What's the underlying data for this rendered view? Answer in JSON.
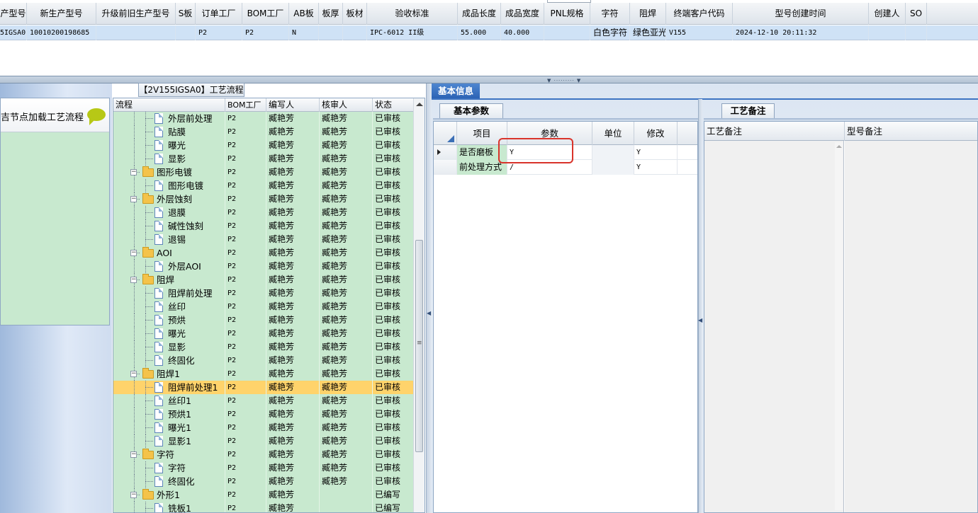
{
  "top_grid": {
    "columns": [
      "产型号",
      "新生产型号",
      "升级前旧生产型号",
      "S板",
      "订单工厂",
      "BOM工厂",
      "AB板",
      "板厚",
      "板材",
      "验收标准",
      "成品长度",
      "成品宽度",
      "PNL规格",
      "字符",
      "阻焊",
      "终端客户代码",
      "型号创建时间",
      "创建人",
      "SO"
    ],
    "row": [
      "5IGSA0",
      "10010200198685",
      "",
      "",
      "P2",
      "P2",
      "N",
      "",
      "",
      "IPC-6012 II级",
      "55.000",
      "40.000",
      "",
      "白色字符",
      "绿色亚光",
      "V155",
      "2024-12-10 20:11:32",
      "",
      ""
    ]
  },
  "left_panel": {
    "header_text": "吉节点加载工艺流程"
  },
  "flow_tab": {
    "title": "【2V155IGSA0】工艺流程"
  },
  "tree_grid": {
    "columns": [
      "流程",
      "BOM工厂",
      "编写人",
      "核审人",
      "状态"
    ],
    "rows": [
      {
        "label": "外层前处理",
        "level": 2,
        "type": "doc",
        "bom": "P2",
        "writer": "臧艳芳",
        "reviewer": "臧艳芳",
        "status": "已审核"
      },
      {
        "label": "贴膜",
        "level": 2,
        "type": "doc",
        "bom": "P2",
        "writer": "臧艳芳",
        "reviewer": "臧艳芳",
        "status": "已审核"
      },
      {
        "label": "曝光",
        "level": 2,
        "type": "doc",
        "bom": "P2",
        "writer": "臧艳芳",
        "reviewer": "臧艳芳",
        "status": "已审核"
      },
      {
        "label": "显影",
        "level": 2,
        "type": "doc",
        "bom": "P2",
        "writer": "臧艳芳",
        "reviewer": "臧艳芳",
        "status": "已审核"
      },
      {
        "label": "图形电镀",
        "level": 1,
        "type": "folder",
        "bom": "P2",
        "writer": "臧艳芳",
        "reviewer": "臧艳芳",
        "status": "已审核"
      },
      {
        "label": "图形电镀",
        "level": 2,
        "type": "doc",
        "bom": "P2",
        "writer": "臧艳芳",
        "reviewer": "臧艳芳",
        "status": "已审核"
      },
      {
        "label": "外层蚀刻",
        "level": 1,
        "type": "folder",
        "bom": "P2",
        "writer": "臧艳芳",
        "reviewer": "臧艳芳",
        "status": "已审核"
      },
      {
        "label": "退膜",
        "level": 2,
        "type": "doc",
        "bom": "P2",
        "writer": "臧艳芳",
        "reviewer": "臧艳芳",
        "status": "已审核"
      },
      {
        "label": "碱性蚀刻",
        "level": 2,
        "type": "doc",
        "bom": "P2",
        "writer": "臧艳芳",
        "reviewer": "臧艳芳",
        "status": "已审核"
      },
      {
        "label": "退锡",
        "level": 2,
        "type": "doc",
        "bom": "P2",
        "writer": "臧艳芳",
        "reviewer": "臧艳芳",
        "status": "已审核"
      },
      {
        "label": "AOI",
        "level": 1,
        "type": "folder",
        "bom": "P2",
        "writer": "臧艳芳",
        "reviewer": "臧艳芳",
        "status": "已审核"
      },
      {
        "label": "外层AOI",
        "level": 2,
        "type": "doc",
        "bom": "P2",
        "writer": "臧艳芳",
        "reviewer": "臧艳芳",
        "status": "已审核"
      },
      {
        "label": "阻焊",
        "level": 1,
        "type": "folder",
        "bom": "P2",
        "writer": "臧艳芳",
        "reviewer": "臧艳芳",
        "status": "已审核"
      },
      {
        "label": "阻焊前处理",
        "level": 2,
        "type": "doc",
        "bom": "P2",
        "writer": "臧艳芳",
        "reviewer": "臧艳芳",
        "status": "已审核"
      },
      {
        "label": "丝印",
        "level": 2,
        "type": "doc",
        "bom": "P2",
        "writer": "臧艳芳",
        "reviewer": "臧艳芳",
        "status": "已审核"
      },
      {
        "label": "预烘",
        "level": 2,
        "type": "doc",
        "bom": "P2",
        "writer": "臧艳芳",
        "reviewer": "臧艳芳",
        "status": "已审核"
      },
      {
        "label": "曝光",
        "level": 2,
        "type": "doc",
        "bom": "P2",
        "writer": "臧艳芳",
        "reviewer": "臧艳芳",
        "status": "已审核"
      },
      {
        "label": "显影",
        "level": 2,
        "type": "doc",
        "bom": "P2",
        "writer": "臧艳芳",
        "reviewer": "臧艳芳",
        "status": "已审核"
      },
      {
        "label": "终固化",
        "level": 2,
        "type": "doc",
        "bom": "P2",
        "writer": "臧艳芳",
        "reviewer": "臧艳芳",
        "status": "已审核"
      },
      {
        "label": "阻焊1",
        "level": 1,
        "type": "folder",
        "bom": "P2",
        "writer": "臧艳芳",
        "reviewer": "臧艳芳",
        "status": "已审核"
      },
      {
        "label": "阻焊前处理1",
        "level": 2,
        "type": "doc",
        "bom": "P2",
        "writer": "臧艳芳",
        "reviewer": "臧艳芳",
        "status": "已审核",
        "selected": true
      },
      {
        "label": "丝印1",
        "level": 2,
        "type": "doc",
        "bom": "P2",
        "writer": "臧艳芳",
        "reviewer": "臧艳芳",
        "status": "已审核"
      },
      {
        "label": "预烘1",
        "level": 2,
        "type": "doc",
        "bom": "P2",
        "writer": "臧艳芳",
        "reviewer": "臧艳芳",
        "status": "已审核"
      },
      {
        "label": "曝光1",
        "level": 2,
        "type": "doc",
        "bom": "P2",
        "writer": "臧艳芳",
        "reviewer": "臧艳芳",
        "status": "已审核"
      },
      {
        "label": "显影1",
        "level": 2,
        "type": "doc",
        "bom": "P2",
        "writer": "臧艳芳",
        "reviewer": "臧艳芳",
        "status": "已审核"
      },
      {
        "label": "字符",
        "level": 1,
        "type": "folder",
        "bom": "P2",
        "writer": "臧艳芳",
        "reviewer": "臧艳芳",
        "status": "已审核"
      },
      {
        "label": "字符",
        "level": 2,
        "type": "doc",
        "bom": "P2",
        "writer": "臧艳芳",
        "reviewer": "臧艳芳",
        "status": "已审核"
      },
      {
        "label": "终固化",
        "level": 2,
        "type": "doc",
        "bom": "P2",
        "writer": "臧艳芳",
        "reviewer": "臧艳芳",
        "status": "已审核"
      },
      {
        "label": "外形1",
        "level": 1,
        "type": "folder",
        "bom": "P2",
        "writer": "臧艳芳",
        "reviewer": "",
        "status": "已编写"
      },
      {
        "label": "铣板1",
        "level": 2,
        "type": "doc",
        "bom": "P2",
        "writer": "臧艳芳",
        "reviewer": "",
        "status": "已编写"
      }
    ]
  },
  "basic_info": {
    "tab_label": "基本信息",
    "param_tab_label": "基本参数",
    "remark_tab_label": "工艺备注",
    "param_columns": [
      "项目",
      "参数",
      "单位",
      "修改"
    ],
    "param_rows": [
      {
        "item": "是否磨板",
        "param": "Y",
        "unit": "",
        "modified": "Y",
        "current": true
      },
      {
        "item": "前处理方式",
        "param": "/",
        "unit": "",
        "modified": "Y",
        "current": false
      }
    ],
    "remark_columns": [
      "工艺备注",
      "型号备注"
    ]
  },
  "colors": {
    "row_green": "#c8e9cf",
    "selected_row": "#ffd36b",
    "active_tab": "#2c63b5",
    "highlight_box": "#d9332a"
  }
}
